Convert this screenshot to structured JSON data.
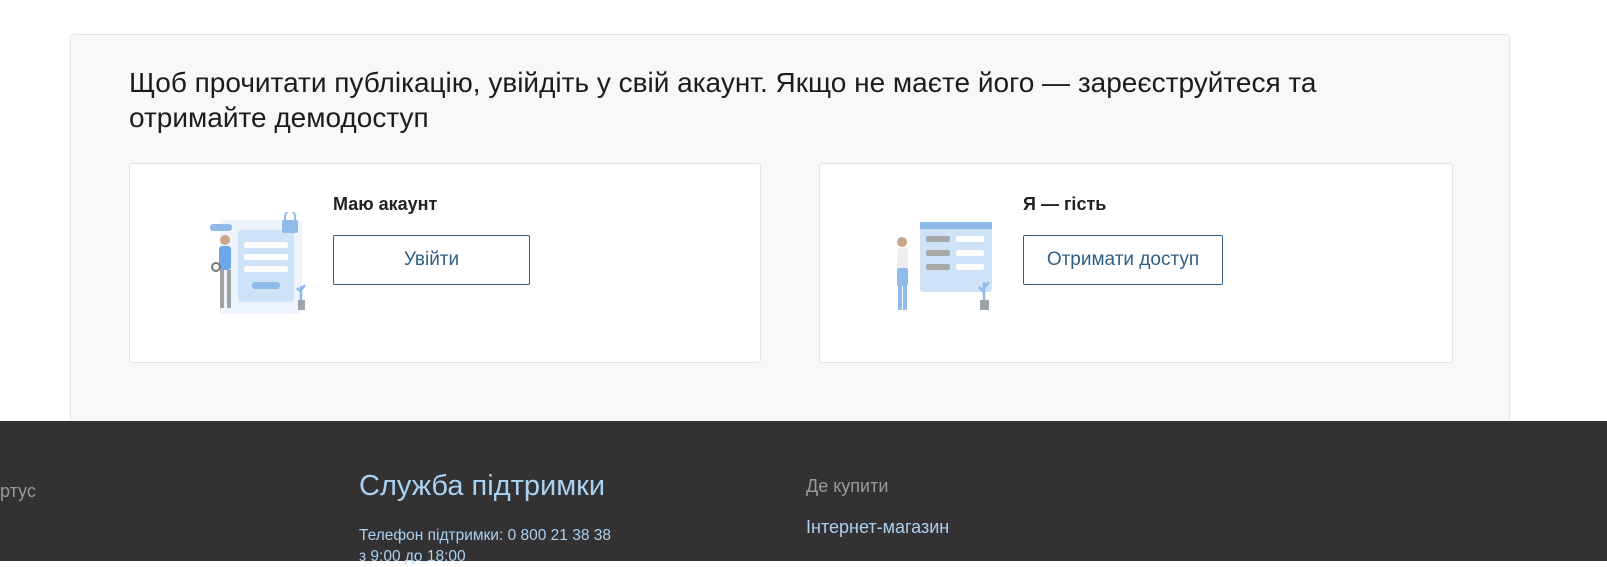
{
  "gate": {
    "title": "Щоб прочитати публікацію, увійдіть у свій акаунт. Якщо не маєте його — зареєструйтеся та отримайте демодоступ",
    "login_card": {
      "title": "Маю акаунт",
      "button": "Увійти"
    },
    "guest_card": {
      "title": "Я — гість",
      "button": "Отримати доступ"
    }
  },
  "footer": {
    "left_text": "ртус",
    "support_title": "Служба підтримки",
    "phone_line1": "Телефон підтримки: 0 800 21 38 38",
    "phone_line2": "з 9:00 до 18:00",
    "buy_title": "Де купити",
    "shop_link": "Інтернет-магазин"
  },
  "colors": {
    "accent": "#2e5f86",
    "footer_bg": "#333132",
    "footer_link": "#a9d2f2",
    "panel_bg": "#f7f8fa"
  }
}
